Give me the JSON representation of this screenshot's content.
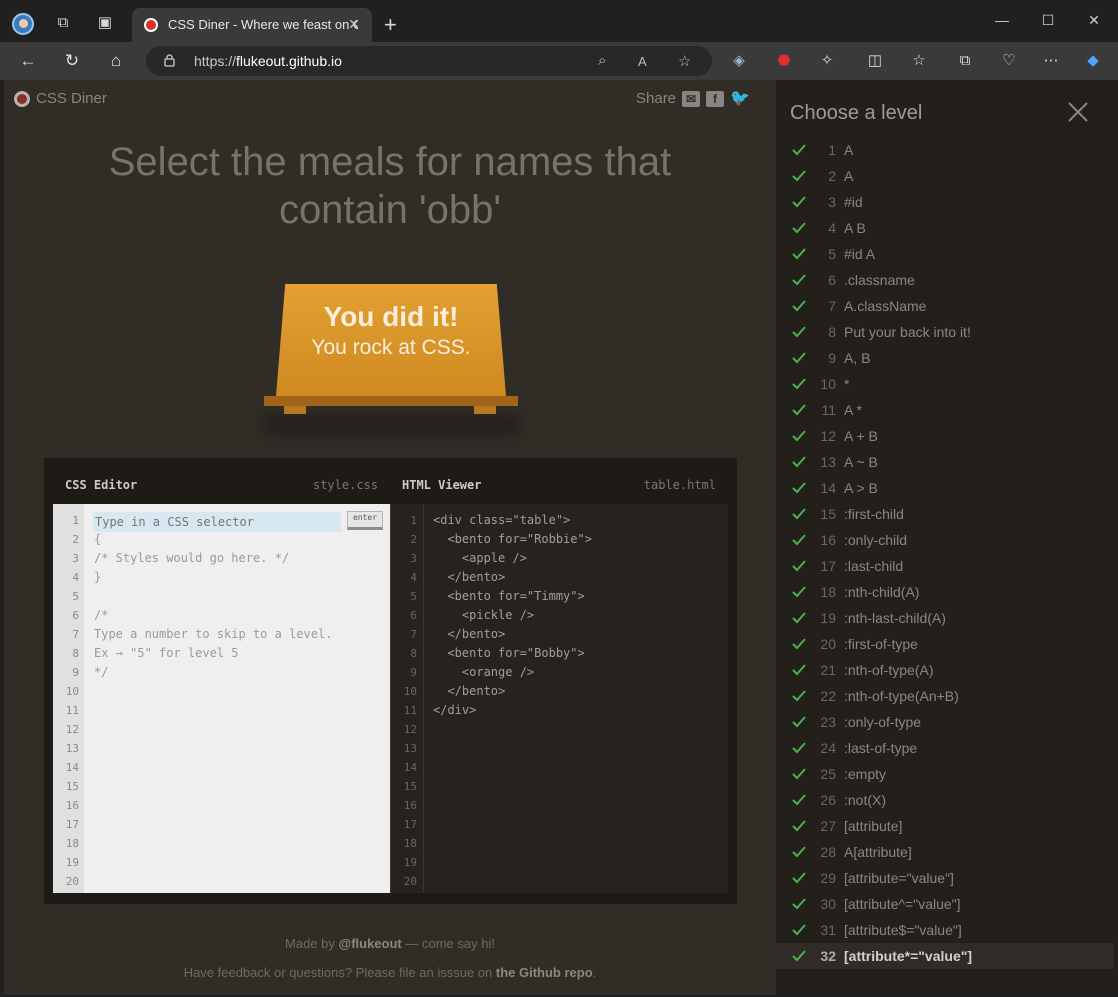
{
  "browser": {
    "tab_title": "CSS Diner - Where we feast on C",
    "url_prefix": "https://",
    "url_domain": "flukeout.github.io"
  },
  "page": {
    "logo_text": "CSS Diner",
    "share_label": "Share",
    "instruction": "Select the meals for names that contain 'obb'",
    "win_line1": "You did it!",
    "win_line2": "You rock at CSS."
  },
  "editor": {
    "css_title": "CSS Editor",
    "css_file": "style.css",
    "html_title": "HTML Viewer",
    "html_file": "table.html",
    "input_placeholder": "Type in a CSS selector",
    "enter_label": "enter",
    "css_lines": [
      "",
      "{",
      "/* Styles would go here. */",
      "}",
      "",
      "/*",
      "Type a number to skip to a level.",
      "Ex → \"5\" for level 5",
      "*/"
    ],
    "html_lines": [
      "<div class=\"table\">",
      "  <bento for=\"Robbie\">",
      "    <apple />",
      "  </bento>",
      "  <bento for=\"Timmy\">",
      "    <pickle />",
      "  </bento>",
      "  <bento for=\"Bobby\">",
      "    <orange />",
      "  </bento>",
      "</div>"
    ],
    "line_numbers": [
      "1",
      "2",
      "3",
      "4",
      "5",
      "6",
      "7",
      "8",
      "9",
      "10",
      "11",
      "12",
      "13",
      "14",
      "15",
      "16",
      "17",
      "18",
      "19",
      "20"
    ]
  },
  "footer": {
    "made_by_prefix": "Made by ",
    "made_by_handle": "@flukeout",
    "made_by_suffix": " — come say hi!",
    "feedback_prefix": "Have feedback or questions? Please file an isssue on ",
    "feedback_link": "the Github repo",
    "feedback_suffix": "."
  },
  "sidebar": {
    "title": "Choose a level",
    "current_level": 32,
    "levels": [
      {
        "num": "1",
        "name": "A"
      },
      {
        "num": "2",
        "name": "A"
      },
      {
        "num": "3",
        "name": "#id"
      },
      {
        "num": "4",
        "name": "A  B"
      },
      {
        "num": "5",
        "name": "#id  A"
      },
      {
        "num": "6",
        "name": ".classname"
      },
      {
        "num": "7",
        "name": "A.className"
      },
      {
        "num": "8",
        "name": "Put your back into it!"
      },
      {
        "num": "9",
        "name": "A, B"
      },
      {
        "num": "10",
        "name": "*"
      },
      {
        "num": "11",
        "name": "A  *"
      },
      {
        "num": "12",
        "name": "A + B"
      },
      {
        "num": "13",
        "name": "A ~ B"
      },
      {
        "num": "14",
        "name": "A > B"
      },
      {
        "num": "15",
        "name": ":first-child"
      },
      {
        "num": "16",
        "name": ":only-child"
      },
      {
        "num": "17",
        "name": ":last-child"
      },
      {
        "num": "18",
        "name": ":nth-child(A)"
      },
      {
        "num": "19",
        "name": ":nth-last-child(A)"
      },
      {
        "num": "20",
        "name": ":first-of-type"
      },
      {
        "num": "21",
        "name": ":nth-of-type(A)"
      },
      {
        "num": "22",
        "name": ":nth-of-type(An+B)"
      },
      {
        "num": "23",
        "name": ":only-of-type"
      },
      {
        "num": "24",
        "name": ":last-of-type"
      },
      {
        "num": "25",
        "name": ":empty"
      },
      {
        "num": "26",
        "name": ":not(X)"
      },
      {
        "num": "27",
        "name": "[attribute]"
      },
      {
        "num": "28",
        "name": "A[attribute]"
      },
      {
        "num": "29",
        "name": "[attribute=\"value\"]"
      },
      {
        "num": "30",
        "name": "[attribute^=\"value\"]"
      },
      {
        "num": "31",
        "name": "[attribute$=\"value\"]"
      },
      {
        "num": "32",
        "name": "[attribute*=\"value\"]"
      }
    ]
  },
  "colors": {
    "check": "#4caf50",
    "table": "#d9952a",
    "page_bg": "#302c26"
  }
}
